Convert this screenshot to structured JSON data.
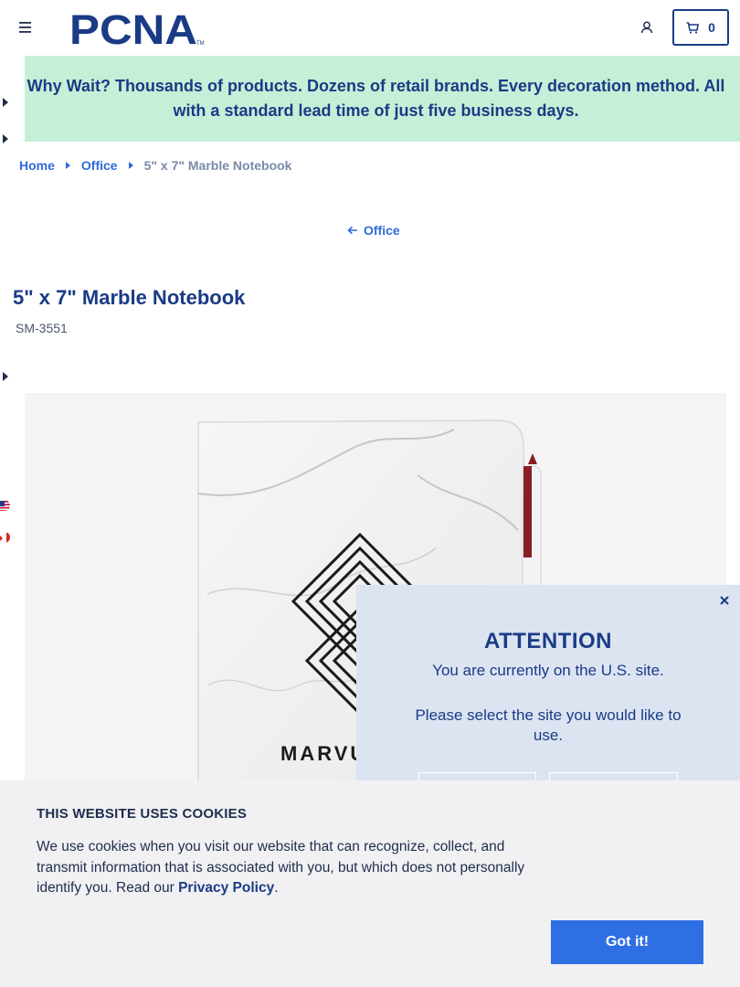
{
  "header": {
    "logo_text": "PCNA",
    "logo_tm": "TM",
    "cart_count": "0"
  },
  "promo": {
    "text": "Why Wait? Thousands of products. Dozens of retail brands. Every decoration method. All with a standard lead time of just five business days."
  },
  "breadcrumb": {
    "home": "Home",
    "category": "Office",
    "current": "5\" x 7\" Marble Notebook"
  },
  "back_link": {
    "label": "Office"
  },
  "product": {
    "title": "5\" x 7\" Marble Notebook",
    "sku": "SM-3551",
    "imprint_text": "MARVU"
  },
  "site_selector": {
    "heading": "ATTENTION",
    "current_site": "You are currently on the U.S. site.",
    "prompt": "Please select the site you would like to use."
  },
  "cookie_banner": {
    "title": "THIS WEBSITE USES COOKIES",
    "body": "We use cookies when you visit our website that can recognize, collect, and transmit information that is associated with you, but which does not personally identify you. Read our ",
    "link_label": "Privacy Policy",
    "after_link": ".",
    "accept_label": "Got it!"
  }
}
